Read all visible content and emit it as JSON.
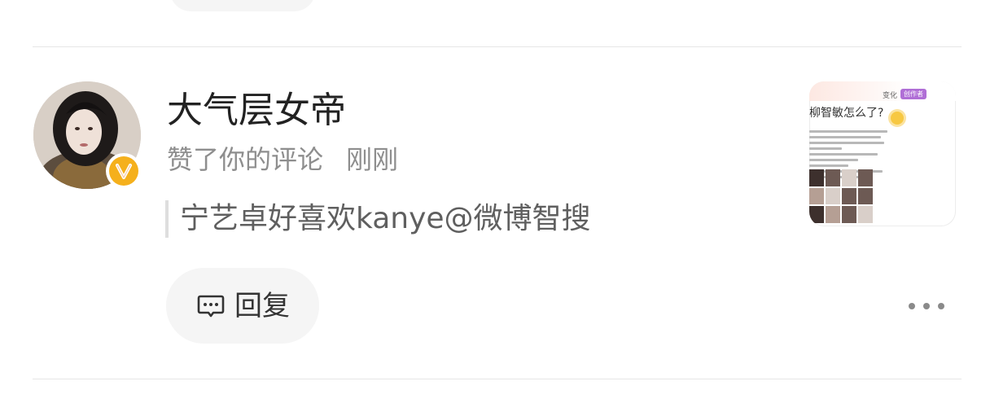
{
  "notification": {
    "username": "大气层女帝",
    "action": "赞了你的评论",
    "time": "刚刚",
    "quoted_comment": "宁艺卓好喜欢kanye@微博智搜",
    "reply_label": "回复",
    "badge": "V"
  },
  "thumbnail": {
    "tag1": "变化",
    "tag2": "创作者",
    "title": "柳智敏怎么了?"
  },
  "colors": {
    "badge": "#f5b01c",
    "text_primary": "#222222",
    "text_secondary": "#8e8e8e",
    "pill_bg": "#f5f5f5"
  },
  "icons": {
    "reply": "comment-bubble-icon",
    "more": "more-dots-icon",
    "badge": "verified-v-icon"
  }
}
